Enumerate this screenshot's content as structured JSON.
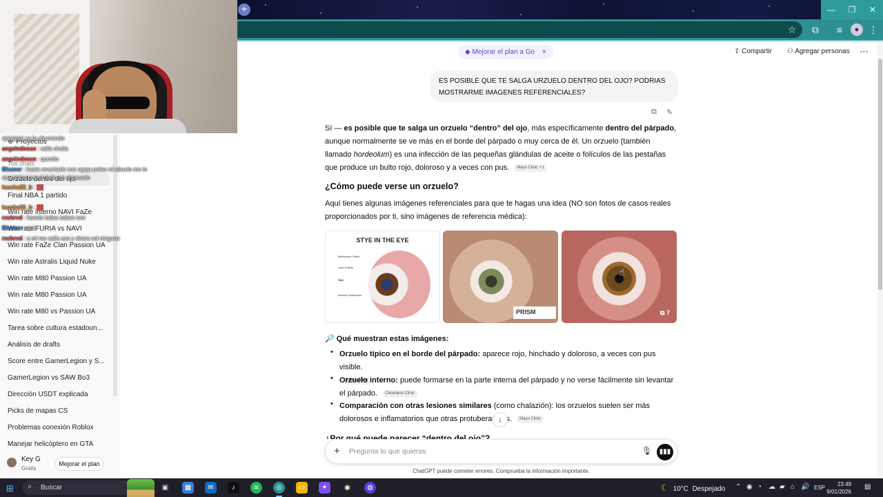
{
  "browser": {
    "new_tab_icon": "+",
    "window_controls": [
      "—",
      "❐",
      "✕"
    ],
    "toolbar_icons": [
      "star-icon",
      "extensions-icon",
      "reading-list-icon",
      "profile-icon",
      "menu-icon"
    ]
  },
  "sidebar": {
    "projects_label": "Proyectos",
    "chats_label": "Tus chats",
    "items": [
      "Orzuelo dentro del ojo",
      "Final NBA 1 partido",
      "Win rate interno NAVI FaZe",
      "Win rate FURIA vs NAVI",
      "Win rate FaZe Clan Passion UA",
      "Win rate Astralis Liquid Nuke",
      "Win rate M80 Passion UA",
      "Win rate M80 Passion UA",
      "Win rate M80 vs Passion UA",
      "Tarea sobre cultura estadoun...",
      "Análisis de drafts",
      "Score entre GamerLegion y S...",
      "GamerLegion vs SAW Bo3",
      "Dirección USDT explicada",
      "Picks de mapas CS",
      "Problemas conexión Roblox",
      "Manejar helicóptero en GTA"
    ],
    "user_name": "Key G",
    "user_plan": "Gratis",
    "upgrade_label": "Mejorar el plan"
  },
  "chat_overlay": [
    {
      "user": "",
      "text": "ajajajajaj ya lo ahumando",
      "color": "#ffffff"
    },
    {
      "user": "angelodosue",
      "text": ": calla chalia",
      "color": "#ff5b5b"
    },
    {
      "user": "angelodosue",
      "text": ": quesito",
      "color": "#ff5b5b"
    },
    {
      "user": "Blezeer",
      "text": ": hasta reventado con aguja pelao mi abuelo me lo",
      "color": "#4fa3ff"
    },
    {
      "user": "",
      "text": "reventaba con el dedo en el pasado",
      "color": "#ffffff"
    },
    {
      "user": "leucha23_b",
      "text": ":",
      "color": "#ff9e3d"
    },
    {
      "user": "leucha23_b",
      "text": ":",
      "color": "#ff9e3d"
    },
    {
      "user": "rxchrvd",
      "text": ": hacelo todos saben eso",
      "color": "#ff5b5b"
    },
    {
      "user": "Blezeer",
      "text": ": quie",
      "color": "#4fa3ff"
    },
    {
      "user": "rxchrvd",
      "text": ": a mi me salio eso y ahora sol ninguno",
      "color": "#ff5b5b"
    }
  ],
  "header": {
    "promo_label": "Mejorar el plan a Go",
    "promo_close": "×",
    "share_label": "Compartir",
    "add_people_label": "Agregar personas",
    "more_icon": "⋯"
  },
  "conversation": {
    "user_message": "ES POSIBLE QUE TE SALGA URZUELO DENTRO DEL OJO? PODRIAS MOSTRARME IMAGENES REFERENCIALES?",
    "intro_parts": {
      "p1": "Sí — ",
      "p2": "es posible que te salga un orzuelo “dentro” del ojo",
      "p3": ", más específicamente ",
      "p4": "dentro del párpado",
      "p5": ", aunque normalmente se ve más en el borde del párpado o muy cerca de él. Un orzuelo (también llamado ",
      "p6": "hordeolum",
      "p7": ") es una infección de las pequeñas glándulas de aceite o folículos de las pestañas que produce un bulto rojo, doloroso y a veces con pus.",
      "cite": "Mayo Clinic +1"
    },
    "heading": "¿Cómo puede verse un orzuelo?",
    "images_intro": "Aquí tienes algunas imágenes referenciales para que te hagas una idea (NO son fotos de casos reales proporcionados por ti, sino imágenes de referencia médica):",
    "images": {
      "diagram_title": "STYE IN THE EYE",
      "diagram_labels": [
        "Meibomian Gland",
        "Lash Follicle",
        "Stye",
        "Internal Hordeolum"
      ],
      "prism_label": "PRISM",
      "more_count": "7"
    },
    "section_title": "🔎 Qué muestran estas imágenes:",
    "bullets": [
      {
        "bold": "Orzuelo típico en el borde del párpado:",
        "text": " aparece rojo, hinchado y doloroso, a veces con pus visible.",
        "cite": "Mayo Clinic"
      },
      {
        "bold": "Orzuelo interno:",
        "text": " puede formarse en la parte interna del párpado y no verse fácilmente sin levantar el párpado.",
        "cite": "Cleveland Clinic"
      },
      {
        "bold": "Comparación con otras lesiones similares",
        "text": " (como chalazión): los orzuelos suelen ser más dolorosos e inflamatorios que otras protuberancias.",
        "cite": "Mayo Clinic"
      }
    ],
    "next_heading": "¿Por qué puede parecer “dentro del ojo”?"
  },
  "composer": {
    "placeholder": "Pregunta lo que quieras",
    "disclaimer": "ChatGPT puede cometer errores. Comprueba la información importante."
  },
  "taskbar": {
    "search_label": "Buscar",
    "weather_temp": "10°C",
    "weather_desc": "Despejado",
    "language": "ESP",
    "time": "23:49",
    "date": "9/01/2026"
  }
}
